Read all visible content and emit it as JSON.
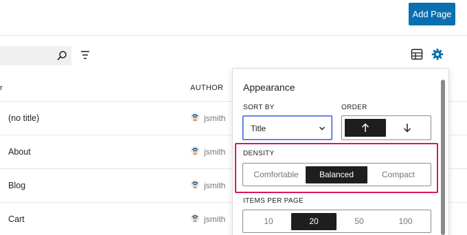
{
  "header": {
    "add_page_label": "Add Page"
  },
  "table": {
    "title_col_partial": "r",
    "author_col": "AUTHOR",
    "rows": [
      {
        "title": "(no title)",
        "author": "jsmith"
      },
      {
        "title": "About",
        "author": "jsmith"
      },
      {
        "title": "Blog",
        "author": "jsmith"
      },
      {
        "title": "Cart",
        "author": "jsmith"
      }
    ]
  },
  "appearance": {
    "title": "Appearance",
    "sort_by_label": "SORT BY",
    "sort_by_value": "Title",
    "order_label": "ORDER",
    "density_label": "DENSITY",
    "density_options": [
      "Comfortable",
      "Balanced",
      "Compact"
    ],
    "density_selected": "Balanced",
    "items_per_page_label": "ITEMS PER PAGE",
    "items_per_page_options": [
      "10",
      "20",
      "50",
      "100"
    ],
    "items_per_page_selected": "20"
  },
  "colors": {
    "accent": "#0a6fb0",
    "highlight": "#d6185b",
    "focus": "#3858e9",
    "dark": "#1e1e1e"
  },
  "icons": [
    "search-icon",
    "filter-icon",
    "table-view-icon",
    "gear-icon",
    "chevron-down-icon",
    "arrow-up-icon",
    "arrow-down-icon",
    "avatar"
  ]
}
